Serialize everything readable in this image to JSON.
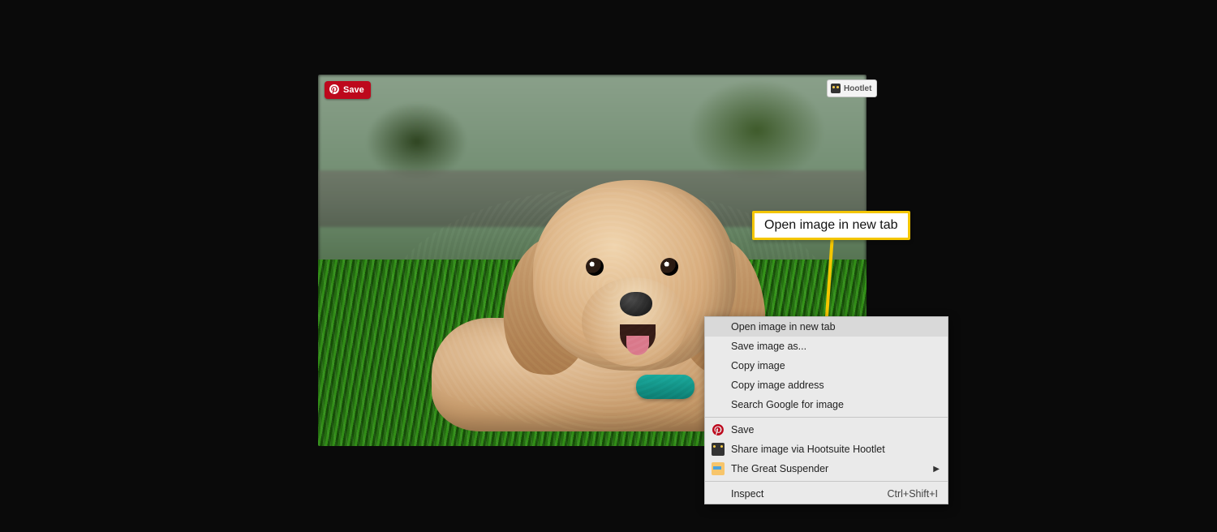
{
  "overlay": {
    "pinterest_save_label": "Save",
    "hootlet_label": "Hootlet"
  },
  "callout": {
    "text": "Open image in new tab"
  },
  "context_menu": {
    "items": [
      {
        "label": "Open image in new tab",
        "highlighted": true
      },
      {
        "label": "Save image as..."
      },
      {
        "label": "Copy image"
      },
      {
        "label": "Copy image address"
      },
      {
        "label": "Search Google for image"
      }
    ],
    "ext_items": [
      {
        "label": "Save",
        "icon": "pinterest"
      },
      {
        "label": "Share image via Hootsuite Hootlet",
        "icon": "hootlet"
      },
      {
        "label": "The Great Suspender",
        "icon": "suspender",
        "submenu": true
      }
    ],
    "inspect": {
      "label": "Inspect",
      "shortcut": "Ctrl+Shift+I"
    }
  }
}
